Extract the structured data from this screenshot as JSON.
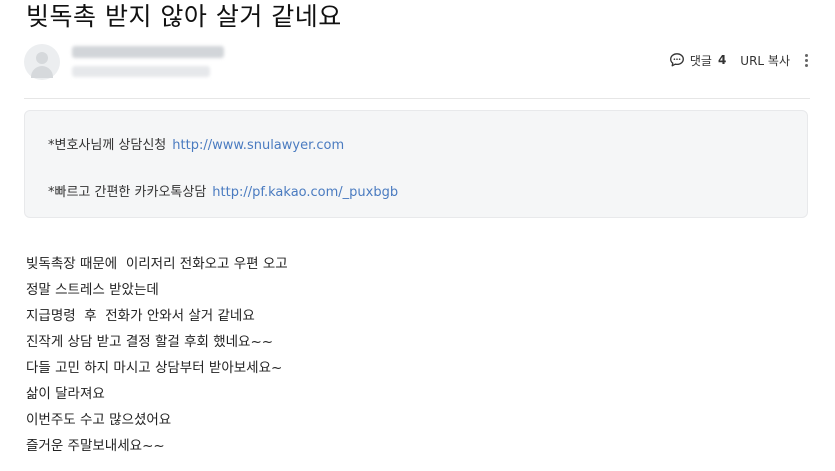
{
  "post": {
    "title": "빚독촉 받지 않아 살거 같네요"
  },
  "actions": {
    "comment_label": "댓글",
    "comment_count": "4",
    "url_copy_label": "URL 복사"
  },
  "notice": {
    "lines": [
      {
        "text": "*변호사님께 상담신청",
        "link": "http://www.snulawyer.com"
      },
      {
        "text": "*빠르고 간편한 카카오톡상담",
        "link": "http://pf.kakao.com/_puxbgb"
      }
    ]
  },
  "body": {
    "lines": [
      "빚독촉장 때문에  이리저리 전화오고 우편 오고",
      "정말 스트레스 받았는데",
      "지급명령  후  전화가 안와서 살거 같네요",
      "진작게 상담 받고 결정 할걸 후회 했네요~~",
      "다들 고민 하지 마시고 상담부터 받아보세요~",
      "삶이 달라져요",
      "이번주도 수고 많으셨어요",
      "즐거운 주말보내세요~~"
    ]
  },
  "colors": {
    "link": "#4a7bc0",
    "notice_bg": "#f5f6f7"
  }
}
